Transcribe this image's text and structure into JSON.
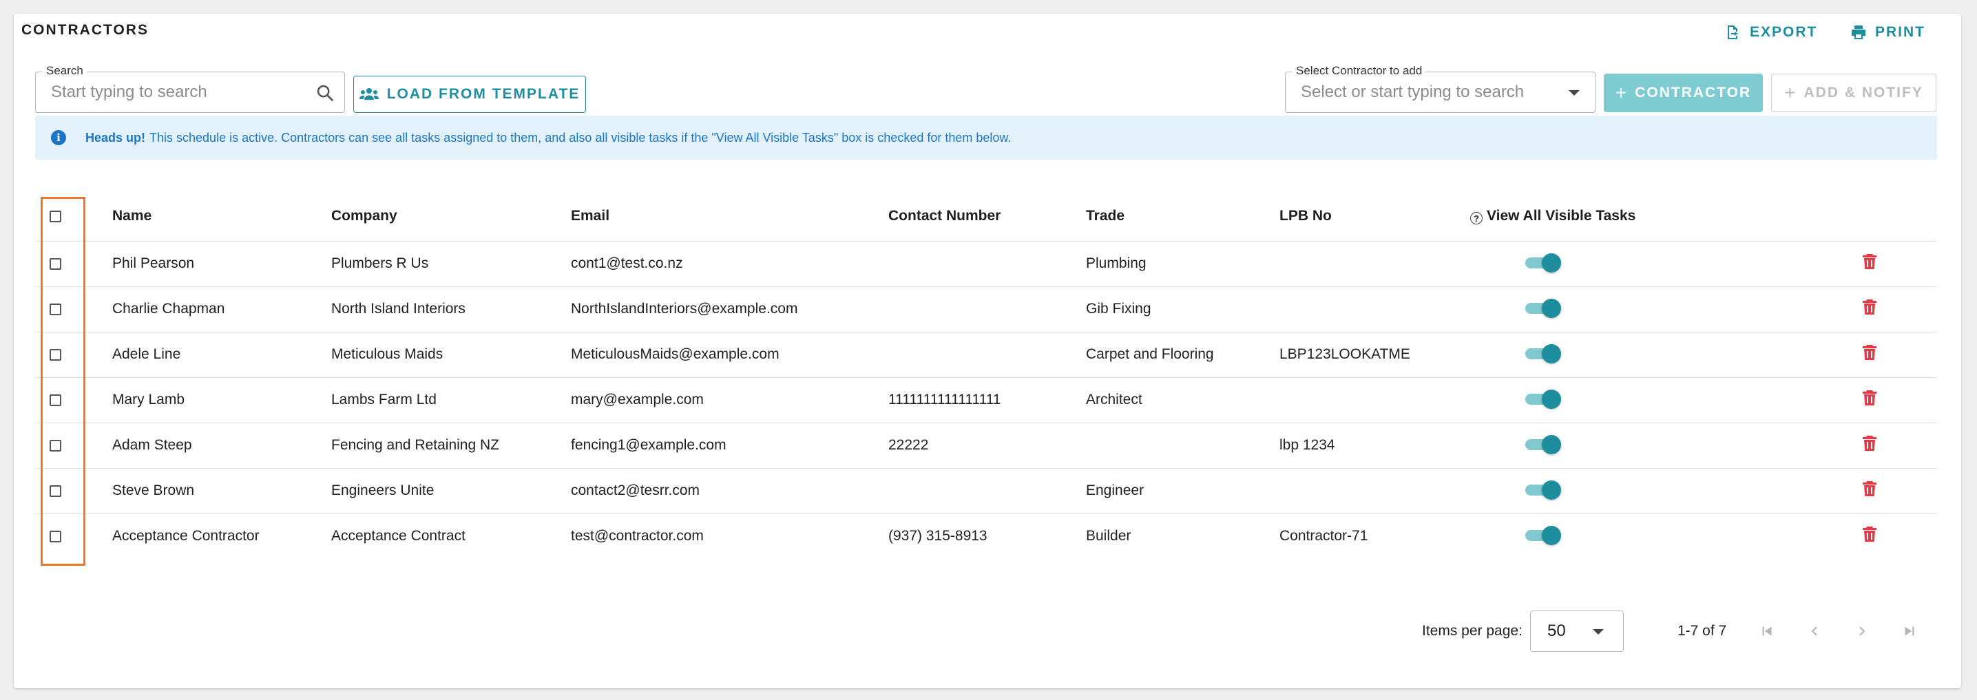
{
  "header": {
    "title": "CONTRACTORS",
    "export_label": "EXPORT",
    "print_label": "PRINT"
  },
  "search": {
    "label": "Search",
    "placeholder": "Start typing to search",
    "value": ""
  },
  "load_template_label": "LOAD FROM TEMPLATE",
  "contractor_select": {
    "label": "Select Contractor to add",
    "placeholder": "Select or start typing to search",
    "value": ""
  },
  "add_contractor_label": "CONTRACTOR",
  "add_notify_label": "ADD & NOTIFY",
  "alert": {
    "strong": "Heads up!",
    "message": "This schedule is active. Contractors can see all tasks assigned to them, and also all visible tasks if the \"View All Visible Tasks\" box is checked for them below."
  },
  "table": {
    "columns": [
      "Name",
      "Company",
      "Email",
      "Contact Number",
      "Trade",
      "LPB No",
      "View All Visible Tasks"
    ],
    "rows": [
      {
        "name": "Phil Pearson",
        "company": "Plumbers R Us",
        "email": "cont1@test.co.nz",
        "contact": "",
        "trade": "Plumbing",
        "lpb": "",
        "view_all": true
      },
      {
        "name": "Charlie Chapman",
        "company": "North Island Interiors",
        "email": "NorthIslandInteriors@example.com",
        "contact": "",
        "trade": "Gib Fixing",
        "lpb": "",
        "view_all": true
      },
      {
        "name": "Adele Line",
        "company": "Meticulous Maids",
        "email": "MeticulousMaids@example.com",
        "contact": "",
        "trade": "Carpet and Flooring",
        "lpb": "LBP123LOOKATME",
        "view_all": true
      },
      {
        "name": "Mary Lamb",
        "company": "Lambs Farm Ltd",
        "email": "mary@example.com",
        "contact": "1111111111111111",
        "trade": "Architect",
        "lpb": "",
        "view_all": true
      },
      {
        "name": "Adam Steep",
        "company": "Fencing and Retaining NZ",
        "email": "fencing1@example.com",
        "contact": "22222",
        "trade": "",
        "lpb": "lbp 1234",
        "view_all": true
      },
      {
        "name": "Steve Brown",
        "company": "Engineers Unite",
        "email": "contact2@tesrr.com",
        "contact": "",
        "trade": "Engineer",
        "lpb": "",
        "view_all": true
      },
      {
        "name": "Acceptance Contractor",
        "company": "Acceptance Contract",
        "email": "test@contractor.com",
        "contact": "(937) 315-8913",
        "trade": "Builder",
        "lpb": "Contractor-71",
        "view_all": true
      }
    ]
  },
  "pagination": {
    "items_per_page_label": "Items per page:",
    "items_per_page": "50",
    "range": "1-7 of 7"
  },
  "colors": {
    "accent": "#1e8e9e",
    "accent_light": "#7fcbd2",
    "info_bg": "#e3f1fb",
    "info_text": "#1b75c8",
    "delete": "#e53945",
    "highlight_box": "#f0762c"
  },
  "icons": {
    "export": "export-icon",
    "print": "print-icon",
    "search": "search-icon",
    "template": "people-icon",
    "info": "info-icon",
    "help": "help-circle-icon",
    "delete": "trash-icon"
  }
}
